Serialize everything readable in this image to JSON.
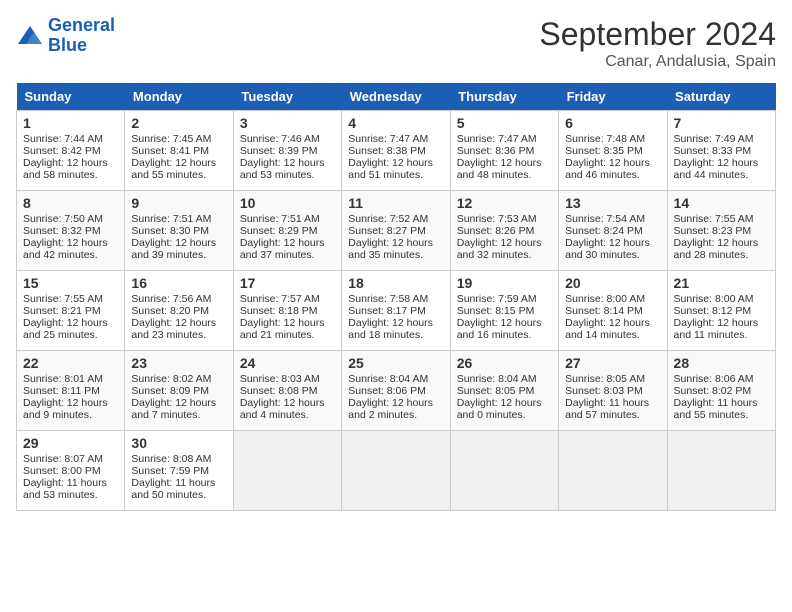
{
  "header": {
    "logo_general": "General",
    "logo_blue": "Blue",
    "title": "September 2024",
    "subtitle": "Canar, Andalusia, Spain"
  },
  "days_of_week": [
    "Sunday",
    "Monday",
    "Tuesday",
    "Wednesday",
    "Thursday",
    "Friday",
    "Saturday"
  ],
  "weeks": [
    [
      {
        "day": 1,
        "sunrise": "7:44 AM",
        "sunset": "8:42 PM",
        "daylight": "12 hours and 58 minutes."
      },
      {
        "day": 2,
        "sunrise": "7:45 AM",
        "sunset": "8:41 PM",
        "daylight": "12 hours and 55 minutes."
      },
      {
        "day": 3,
        "sunrise": "7:46 AM",
        "sunset": "8:39 PM",
        "daylight": "12 hours and 53 minutes."
      },
      {
        "day": 4,
        "sunrise": "7:47 AM",
        "sunset": "8:38 PM",
        "daylight": "12 hours and 51 minutes."
      },
      {
        "day": 5,
        "sunrise": "7:47 AM",
        "sunset": "8:36 PM",
        "daylight": "12 hours and 48 minutes."
      },
      {
        "day": 6,
        "sunrise": "7:48 AM",
        "sunset": "8:35 PM",
        "daylight": "12 hours and 46 minutes."
      },
      {
        "day": 7,
        "sunrise": "7:49 AM",
        "sunset": "8:33 PM",
        "daylight": "12 hours and 44 minutes."
      }
    ],
    [
      {
        "day": 8,
        "sunrise": "7:50 AM",
        "sunset": "8:32 PM",
        "daylight": "12 hours and 42 minutes."
      },
      {
        "day": 9,
        "sunrise": "7:51 AM",
        "sunset": "8:30 PM",
        "daylight": "12 hours and 39 minutes."
      },
      {
        "day": 10,
        "sunrise": "7:51 AM",
        "sunset": "8:29 PM",
        "daylight": "12 hours and 37 minutes."
      },
      {
        "day": 11,
        "sunrise": "7:52 AM",
        "sunset": "8:27 PM",
        "daylight": "12 hours and 35 minutes."
      },
      {
        "day": 12,
        "sunrise": "7:53 AM",
        "sunset": "8:26 PM",
        "daylight": "12 hours and 32 minutes."
      },
      {
        "day": 13,
        "sunrise": "7:54 AM",
        "sunset": "8:24 PM",
        "daylight": "12 hours and 30 minutes."
      },
      {
        "day": 14,
        "sunrise": "7:55 AM",
        "sunset": "8:23 PM",
        "daylight": "12 hours and 28 minutes."
      }
    ],
    [
      {
        "day": 15,
        "sunrise": "7:55 AM",
        "sunset": "8:21 PM",
        "daylight": "12 hours and 25 minutes."
      },
      {
        "day": 16,
        "sunrise": "7:56 AM",
        "sunset": "8:20 PM",
        "daylight": "12 hours and 23 minutes."
      },
      {
        "day": 17,
        "sunrise": "7:57 AM",
        "sunset": "8:18 PM",
        "daylight": "12 hours and 21 minutes."
      },
      {
        "day": 18,
        "sunrise": "7:58 AM",
        "sunset": "8:17 PM",
        "daylight": "12 hours and 18 minutes."
      },
      {
        "day": 19,
        "sunrise": "7:59 AM",
        "sunset": "8:15 PM",
        "daylight": "12 hours and 16 minutes."
      },
      {
        "day": 20,
        "sunrise": "8:00 AM",
        "sunset": "8:14 PM",
        "daylight": "12 hours and 14 minutes."
      },
      {
        "day": 21,
        "sunrise": "8:00 AM",
        "sunset": "8:12 PM",
        "daylight": "12 hours and 11 minutes."
      }
    ],
    [
      {
        "day": 22,
        "sunrise": "8:01 AM",
        "sunset": "8:11 PM",
        "daylight": "12 hours and 9 minutes."
      },
      {
        "day": 23,
        "sunrise": "8:02 AM",
        "sunset": "8:09 PM",
        "daylight": "12 hours and 7 minutes."
      },
      {
        "day": 24,
        "sunrise": "8:03 AM",
        "sunset": "8:08 PM",
        "daylight": "12 hours and 4 minutes."
      },
      {
        "day": 25,
        "sunrise": "8:04 AM",
        "sunset": "8:06 PM",
        "daylight": "12 hours and 2 minutes."
      },
      {
        "day": 26,
        "sunrise": "8:04 AM",
        "sunset": "8:05 PM",
        "daylight": "12 hours and 0 minutes."
      },
      {
        "day": 27,
        "sunrise": "8:05 AM",
        "sunset": "8:03 PM",
        "daylight": "11 hours and 57 minutes."
      },
      {
        "day": 28,
        "sunrise": "8:06 AM",
        "sunset": "8:02 PM",
        "daylight": "11 hours and 55 minutes."
      }
    ],
    [
      {
        "day": 29,
        "sunrise": "8:07 AM",
        "sunset": "8:00 PM",
        "daylight": "11 hours and 53 minutes."
      },
      {
        "day": 30,
        "sunrise": "8:08 AM",
        "sunset": "7:59 PM",
        "daylight": "11 hours and 50 minutes."
      },
      null,
      null,
      null,
      null,
      null
    ]
  ]
}
